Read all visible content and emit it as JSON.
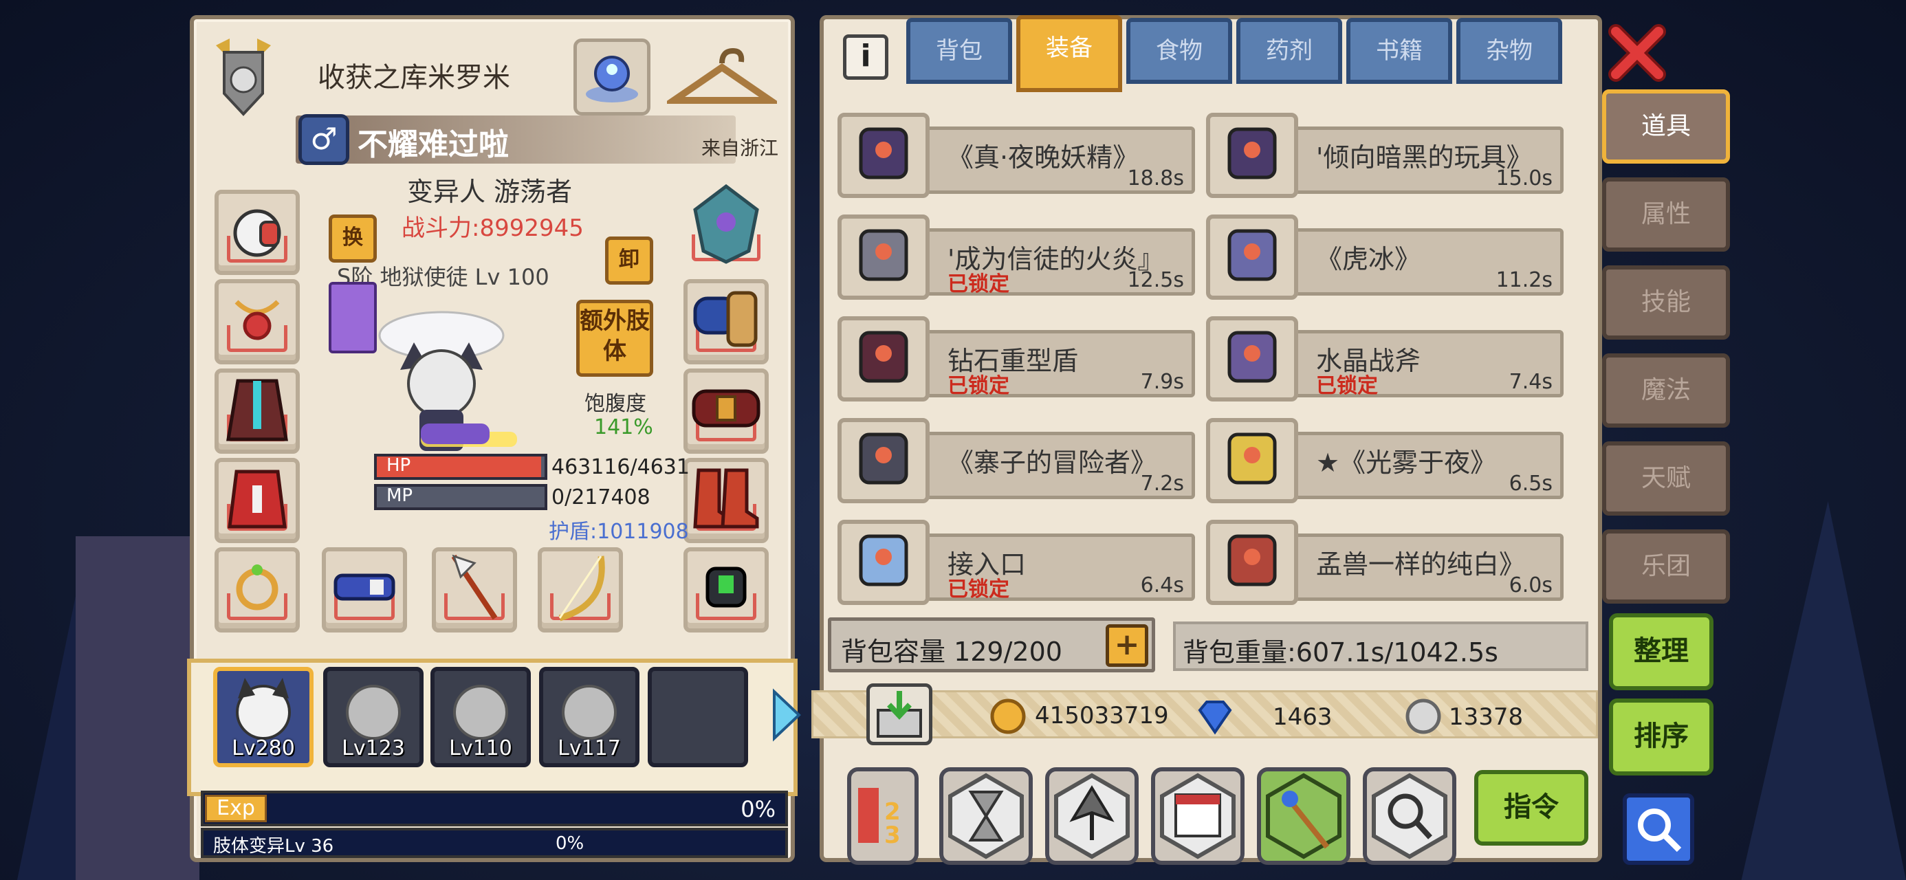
{
  "character": {
    "title": "收获之库米罗米",
    "name": "不耀难过啦",
    "origin": "来自浙江",
    "class": "变异人 游荡者",
    "power": "战斗力:8992945",
    "weapon_info": "S阶 地狱使徒 Lv 100",
    "swap_label": "换",
    "unequip_label": "卸",
    "extra_limb_label": "额外肢体",
    "satiety_label": "饱腹度",
    "satiety_value": "141%",
    "hp_label": "HP",
    "hp_value": "463116/4631",
    "hp_fill_fraction": 0.98,
    "mp_label": "MP",
    "mp_value": "0/217408",
    "mp_fill_fraction": 0.0,
    "shield": "护盾:1011908",
    "exp_label": "Exp",
    "exp_percent": "0%",
    "limb_level": "肢体变异Lv 36",
    "limb_percent": "0%"
  },
  "team": [
    {
      "level": "Lv280",
      "active": true
    },
    {
      "level": "Lv123",
      "active": false
    },
    {
      "level": "Lv110",
      "active": false
    },
    {
      "level": "Lv117",
      "active": false
    },
    {
      "level": "",
      "active": false
    }
  ],
  "tabs": [
    "背包",
    "装备",
    "食物",
    "药剂",
    "书籍",
    "杂物"
  ],
  "active_tab": "装备",
  "items": [
    {
      "name": "《真·夜晚妖精》",
      "time": "18.8s",
      "locked": ""
    },
    {
      "name": "'倾向暗黑的玩具》",
      "time": "15.0s",
      "locked": ""
    },
    {
      "name": "'成为信徒的火炎』",
      "time": "12.5s",
      "locked": "已锁定"
    },
    {
      "name": "《虎冰》",
      "time": "11.2s",
      "locked": ""
    },
    {
      "name": "钻石重型盾",
      "time": "7.9s",
      "locked": "已锁定"
    },
    {
      "name": "水晶战斧",
      "time": "7.4s",
      "locked": "已锁定"
    },
    {
      "name": "《寨子的冒险者》",
      "time": "7.2s",
      "locked": ""
    },
    {
      "name": "★《光雾于夜》",
      "time": "6.5s",
      "locked": ""
    },
    {
      "name": "接入口",
      "time": "6.4s",
      "locked": "已锁定"
    },
    {
      "name": "孟兽一样的纯白》",
      "time": "6.0s",
      "locked": ""
    }
  ],
  "bag": {
    "capacity": "背包容量 129/200",
    "weight": "背包重量:607.1s/1042.5s",
    "add_label": "+"
  },
  "currency": {
    "gold": "415033719",
    "diamond": "1463",
    "silver": "13378"
  },
  "side_tabs": [
    "道具",
    "属性",
    "技能",
    "魔法",
    "天赋",
    "乐团"
  ],
  "active_side_tab": "道具",
  "buttons": {
    "organize": "整理",
    "sort": "排序",
    "command": "指令",
    "info": "i",
    "close": "✕"
  },
  "colors": {
    "accent": "#f0b33b",
    "power": "#d8473f",
    "satiety": "#3a9a2a",
    "shield": "#4a6fd0",
    "locked": "#cc2a1d",
    "hp_fill": "#e0503f"
  }
}
